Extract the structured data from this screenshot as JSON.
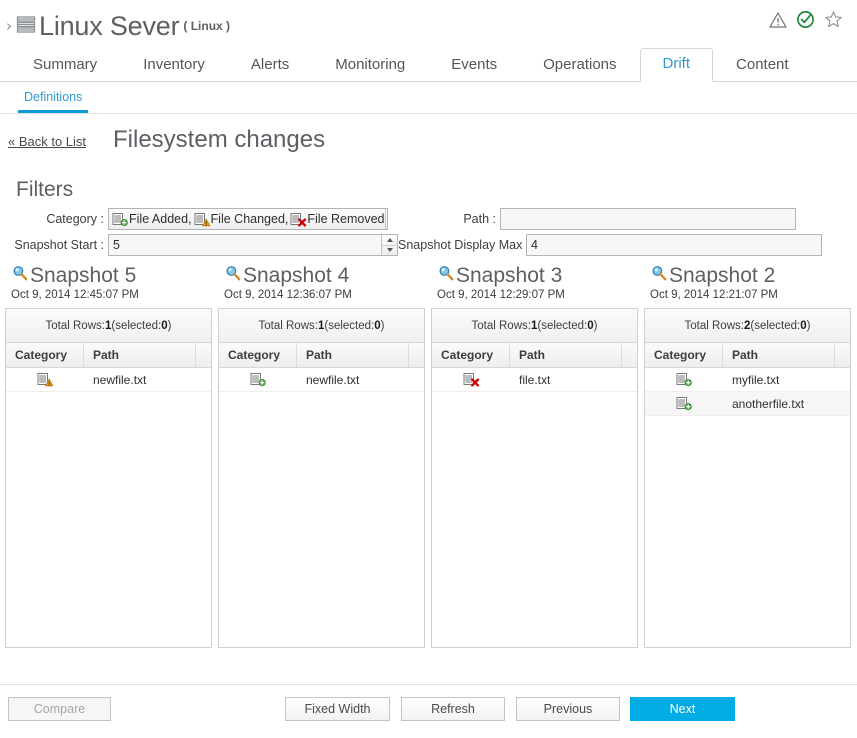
{
  "header": {
    "expand_chevron": "›",
    "resource_name": "Linux Sever",
    "resource_type": "( Linux )",
    "icons": [
      {
        "name": "alert-warning-icon",
        "label": "warning-triangle"
      },
      {
        "name": "availability-up-icon",
        "label": "green-check-circle"
      },
      {
        "name": "favorite-star-icon",
        "label": "star-outline"
      }
    ]
  },
  "tabs": [
    {
      "label": "Summary",
      "active": false
    },
    {
      "label": "Inventory",
      "active": false
    },
    {
      "label": "Alerts",
      "active": false
    },
    {
      "label": "Monitoring",
      "active": false
    },
    {
      "label": "Events",
      "active": false
    },
    {
      "label": "Operations",
      "active": false
    },
    {
      "label": "Drift",
      "active": true
    },
    {
      "label": "Content",
      "active": false
    }
  ],
  "subtabs": [
    {
      "label": "Definitions",
      "active": true
    }
  ],
  "view": {
    "back_link": "« Back to List",
    "title": "Filesystem changes",
    "filters_heading": "Filters"
  },
  "filters": {
    "category_label": "Category :",
    "category_value": "File Added, File Changed, File Removed",
    "category_items": [
      {
        "icon": "file-added-icon",
        "text": "File Added,"
      },
      {
        "icon": "file-changed-icon",
        "text": "File Changed,"
      },
      {
        "icon": "file-removed-icon",
        "text": "File Removed"
      }
    ],
    "path_label": "Path :",
    "path_value": "",
    "path_placeholder": "",
    "snapshot_start_label": "Snapshot Start :",
    "snapshot_start_value": "5",
    "snapshot_display_max_label": "Snapshot Display Max :",
    "snapshot_display_max_value": "4"
  },
  "grid": {
    "columns": [
      "Category",
      "Path"
    ],
    "total_prefix": "Total Rows: ",
    "selected_prefix": " (selected: ",
    "selected_suffix": ")"
  },
  "snapshots": [
    {
      "title": "Snapshot 5",
      "date": "Oct 9, 2014 12:45:07 PM",
      "total_rows": "1",
      "selected": "0",
      "rows": [
        {
          "category_icon": "file-changed-icon",
          "path": "newfile.txt"
        }
      ]
    },
    {
      "title": "Snapshot 4",
      "date": "Oct 9, 2014 12:36:07 PM",
      "total_rows": "1",
      "selected": "0",
      "rows": [
        {
          "category_icon": "file-added-icon",
          "path": "newfile.txt"
        }
      ]
    },
    {
      "title": "Snapshot 3",
      "date": "Oct 9, 2014 12:29:07 PM",
      "total_rows": "1",
      "selected": "0",
      "rows": [
        {
          "category_icon": "file-removed-icon",
          "path": "file.txt"
        }
      ]
    },
    {
      "title": "Snapshot 2",
      "date": "Oct 9, 2014 12:21:07 PM",
      "total_rows": "2",
      "selected": "0",
      "rows": [
        {
          "category_icon": "file-added-icon",
          "path": "myfile.txt"
        },
        {
          "category_icon": "file-added-icon",
          "path": "anotherfile.txt"
        }
      ]
    }
  ],
  "footer": {
    "compare": "Compare",
    "fixed_width": "Fixed Width",
    "refresh": "Refresh",
    "previous": "Previous",
    "next": "Next"
  },
  "colors": {
    "accent_blue": "#00ace3",
    "tab_active": "#2e9ad0",
    "added_green": "#3f9c35",
    "changed_orange": "#e8a317",
    "removed_red": "#cc0000",
    "status_ok_green": "#3f9c35",
    "text_gray": "#5c5f63"
  }
}
